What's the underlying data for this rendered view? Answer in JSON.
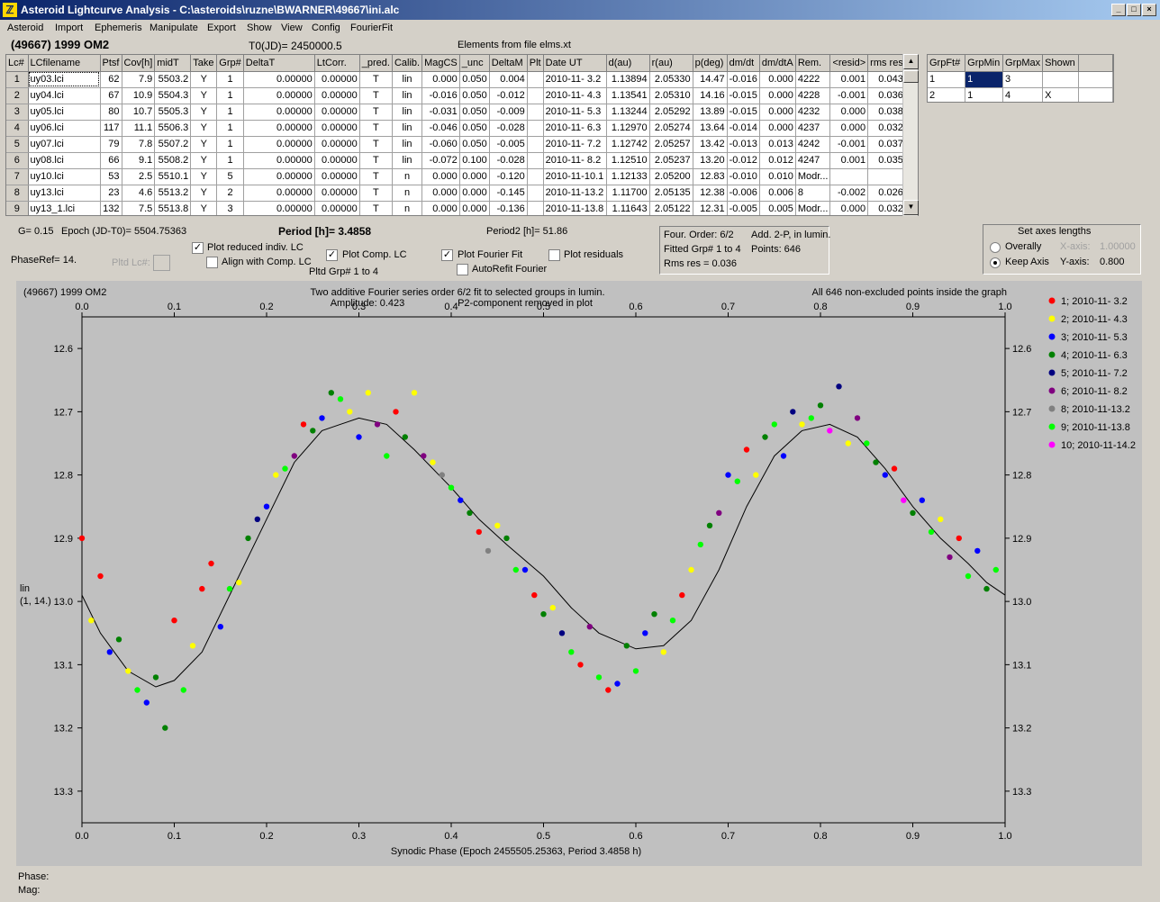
{
  "window": {
    "title": "Asteroid Lightcurve Analysis - C:\\asteroids\\ruzne\\BWARNER\\49667\\ini.alc",
    "buttons": [
      "_",
      "□",
      "×"
    ]
  },
  "menu": [
    "Asteroid",
    "Import",
    "Ephemeris",
    "Manipulate",
    "Export",
    "Show",
    "View",
    "Config",
    "FourierFit"
  ],
  "header": {
    "object": "(49667) 1999 OM2",
    "t0": "T0(JD)= 2450000.5",
    "elements": "Elements from file elms.xt"
  },
  "lc_table": {
    "columns": [
      "Lc#",
      "LCfilename",
      "Ptsf",
      "Cov[h]",
      "midT",
      "Take",
      "Grp#",
      "DeltaT",
      "LtCorr.",
      "_pred.",
      "Calib.",
      "MagCS",
      "_unc",
      "DeltaM",
      "Plt",
      "Date UT",
      "d(au)",
      "r(au)",
      "p(deg)",
      "dm/dt",
      "dm/dtA",
      "Rem.",
      "<resid>",
      "rms res"
    ],
    "rows": [
      [
        "1",
        "uy03.lci",
        "62",
        "7.9",
        "5503.2",
        "Y",
        "1",
        "0.00000",
        "0.00000",
        "T",
        "lin",
        "0.000",
        "0.050",
        "0.004",
        "",
        "2010-11- 3.2",
        "1.13894",
        "2.05330",
        "14.47",
        "-0.016",
        "0.000",
        "4222",
        "0.001",
        "0.043"
      ],
      [
        "2",
        "uy04.lci",
        "67",
        "10.9",
        "5504.3",
        "Y",
        "1",
        "0.00000",
        "0.00000",
        "T",
        "lin",
        "-0.016",
        "0.050",
        "-0.012",
        "",
        "2010-11- 4.3",
        "1.13541",
        "2.05310",
        "14.16",
        "-0.015",
        "0.000",
        "4228",
        "-0.001",
        "0.036"
      ],
      [
        "3",
        "uy05.lci",
        "80",
        "10.7",
        "5505.3",
        "Y",
        "1",
        "0.00000",
        "0.00000",
        "T",
        "lin",
        "-0.031",
        "0.050",
        "-0.009",
        "",
        "2010-11- 5.3",
        "1.13244",
        "2.05292",
        "13.89",
        "-0.015",
        "0.000",
        "4232",
        "0.000",
        "0.038"
      ],
      [
        "4",
        "uy06.lci",
        "117",
        "11.1",
        "5506.3",
        "Y",
        "1",
        "0.00000",
        "0.00000",
        "T",
        "lin",
        "-0.046",
        "0.050",
        "-0.028",
        "",
        "2010-11- 6.3",
        "1.12970",
        "2.05274",
        "13.64",
        "-0.014",
        "0.000",
        "4237",
        "0.000",
        "0.032"
      ],
      [
        "5",
        "uy07.lci",
        "79",
        "7.8",
        "5507.2",
        "Y",
        "1",
        "0.00000",
        "0.00000",
        "T",
        "lin",
        "-0.060",
        "0.050",
        "-0.005",
        "",
        "2010-11- 7.2",
        "1.12742",
        "2.05257",
        "13.42",
        "-0.013",
        "0.013",
        "4242",
        "-0.001",
        "0.037"
      ],
      [
        "6",
        "uy08.lci",
        "66",
        "9.1",
        "5508.2",
        "Y",
        "1",
        "0.00000",
        "0.00000",
        "T",
        "lin",
        "-0.072",
        "0.100",
        "-0.028",
        "",
        "2010-11- 8.2",
        "1.12510",
        "2.05237",
        "13.20",
        "-0.012",
        "0.012",
        "4247",
        "0.001",
        "0.035"
      ],
      [
        "7",
        "uy10.lci",
        "53",
        "2.5",
        "5510.1",
        "Y",
        "5",
        "0.00000",
        "0.00000",
        "T",
        "n",
        "0.000",
        "0.000",
        "-0.120",
        "",
        "2010-11-10.1",
        "1.12133",
        "2.05200",
        "12.83",
        "-0.010",
        "0.010",
        "Modr...",
        "",
        ""
      ],
      [
        "8",
        "uy13.lci",
        "23",
        "4.6",
        "5513.2",
        "Y",
        "2",
        "0.00000",
        "0.00000",
        "T",
        "n",
        "0.000",
        "0.000",
        "-0.145",
        "",
        "2010-11-13.2",
        "1.11700",
        "2.05135",
        "12.38",
        "-0.006",
        "0.006",
        "8",
        "-0.002",
        "0.026"
      ],
      [
        "9",
        "uy13_1.lci",
        "132",
        "7.5",
        "5513.8",
        "Y",
        "3",
        "0.00000",
        "0.00000",
        "T",
        "n",
        "0.000",
        "0.000",
        "-0.136",
        "",
        "2010-11-13.8",
        "1.11643",
        "2.05122",
        "12.31",
        "-0.005",
        "0.005",
        "Modr...",
        "0.000",
        "0.032"
      ]
    ]
  },
  "grp_table": {
    "columns": [
      "GrpFt#",
      "GrpMin",
      "GrpMax",
      "Shown"
    ],
    "rows": [
      [
        "1",
        "1",
        "3",
        ""
      ],
      [
        "2",
        "1",
        "4",
        "X"
      ]
    ]
  },
  "controls": {
    "g": "G= 0.15",
    "epoch": "Epoch (JD-T0)= 5504.75363",
    "period": "Period [h]= 3.4858",
    "period2": "Period2 [h]= 51.86",
    "phaseref": "PhaseRef= 14.",
    "pltd_lc": "Pltd Lc#:",
    "plot_reduced": "Plot reduced indiv. LC",
    "align_comp": "Align with Comp. LC",
    "plot_comp": "Plot Comp. LC",
    "pltd_grp": "Pltd Grp#  1   to   4",
    "plot_fourier": "Plot Fourier Fit",
    "autorefit": "AutoRefit Fourier",
    "plot_residuals": "Plot residuals",
    "checks": {
      "plot_reduced": true,
      "align_comp": false,
      "plot_comp": true,
      "plot_fourier": true,
      "autorefit": false,
      "plot_residuals": false
    }
  },
  "fourier_info": {
    "order": "Four. Order:  6/2",
    "add": "Add. 2-P, in lumin.",
    "fitted": "Fitted Grp# 1 to 4",
    "points": "Points: 646",
    "rms": "Rms res      = 0.036"
  },
  "axes_panel": {
    "title": "Set axes lengths",
    "overally": "Overally",
    "keep": "Keep Axis",
    "xlabel": "X-axis:",
    "xvalue": "1.00000",
    "ylabel": "Y-axis:",
    "yvalue": "0.800",
    "selected": "keep"
  },
  "chart_data": {
    "type": "scatter",
    "title": "Two additive Fourier series order 6/2 fit to selected groups in lumin.",
    "subtitle_left": "Amplitude: 0.423",
    "subtitle_right": "P2-component removed in plot",
    "object_label": "(49667) 1999 OM2",
    "right_note": "All 646 non-excluded points inside the graph",
    "xlabel": "Synodic Phase (Epoch 2455505.25363, Period 3.4858 h)",
    "ylabel": [
      "lin",
      "(1, 14.)"
    ],
    "xlim": [
      0,
      1
    ],
    "ylim": [
      13.35,
      12.55
    ],
    "xticks": [
      "0.0",
      "0.1",
      "0.2",
      "0.3",
      "0.4",
      "0.5",
      "0.6",
      "0.7",
      "0.8",
      "0.9",
      "1.0"
    ],
    "yticks": [
      "12.6",
      "12.7",
      "12.8",
      "12.9",
      "13.0",
      "13.1",
      "13.2",
      "13.3"
    ],
    "legend_position": "right",
    "series": [
      {
        "name": "1; 2010-11- 3.2",
        "color": "#ff0000"
      },
      {
        "name": "2; 2010-11- 4.3",
        "color": "#ffff00"
      },
      {
        "name": "3; 2010-11- 5.3",
        "color": "#0000ff"
      },
      {
        "name": "4; 2010-11- 6.3",
        "color": "#008000"
      },
      {
        "name": "5; 2010-11- 7.2",
        "color": "#000080"
      },
      {
        "name": "6; 2010-11- 8.2",
        "color": "#800080"
      },
      {
        "name": "8; 2010-11-13.2",
        "color": "#808080"
      },
      {
        "name": "9; 2010-11-13.8",
        "color": "#00ff00"
      },
      {
        "name": "10; 2010-11-14.2",
        "color": "#ff00ff"
      }
    ],
    "fit_curve": [
      [
        0.0,
        12.99
      ],
      [
        0.02,
        13.05
      ],
      [
        0.05,
        13.11
      ],
      [
        0.08,
        13.135
      ],
      [
        0.1,
        13.125
      ],
      [
        0.13,
        13.08
      ],
      [
        0.16,
        12.99
      ],
      [
        0.2,
        12.87
      ],
      [
        0.23,
        12.78
      ],
      [
        0.26,
        12.73
      ],
      [
        0.3,
        12.71
      ],
      [
        0.33,
        12.72
      ],
      [
        0.36,
        12.76
      ],
      [
        0.4,
        12.82
      ],
      [
        0.43,
        12.87
      ],
      [
        0.46,
        12.91
      ],
      [
        0.5,
        12.96
      ],
      [
        0.53,
        13.01
      ],
      [
        0.56,
        13.05
      ],
      [
        0.6,
        13.075
      ],
      [
        0.63,
        13.07
      ],
      [
        0.66,
        13.03
      ],
      [
        0.69,
        12.95
      ],
      [
        0.72,
        12.85
      ],
      [
        0.75,
        12.77
      ],
      [
        0.78,
        12.73
      ],
      [
        0.81,
        12.72
      ],
      [
        0.84,
        12.74
      ],
      [
        0.87,
        12.79
      ],
      [
        0.9,
        12.85
      ],
      [
        0.93,
        12.9
      ],
      [
        0.96,
        12.94
      ],
      [
        0.98,
        12.97
      ],
      [
        1.0,
        12.99
      ]
    ],
    "points": [
      [
        0.0,
        12.9,
        0
      ],
      [
        0.01,
        13.03,
        1
      ],
      [
        0.02,
        12.96,
        0
      ],
      [
        0.03,
        13.08,
        2
      ],
      [
        0.04,
        13.06,
        3
      ],
      [
        0.05,
        13.11,
        1
      ],
      [
        0.06,
        13.14,
        7
      ],
      [
        0.07,
        13.16,
        2
      ],
      [
        0.08,
        13.12,
        3
      ],
      [
        0.09,
        13.2,
        3
      ],
      [
        0.1,
        13.03,
        0
      ],
      [
        0.11,
        13.14,
        7
      ],
      [
        0.12,
        13.07,
        1
      ],
      [
        0.13,
        12.98,
        0
      ],
      [
        0.14,
        12.94,
        0
      ],
      [
        0.15,
        13.04,
        2
      ],
      [
        0.16,
        12.98,
        7
      ],
      [
        0.17,
        12.97,
        1
      ],
      [
        0.18,
        12.9,
        3
      ],
      [
        0.19,
        12.87,
        4
      ],
      [
        0.2,
        12.85,
        2
      ],
      [
        0.21,
        12.8,
        1
      ],
      [
        0.22,
        12.79,
        7
      ],
      [
        0.23,
        12.77,
        5
      ],
      [
        0.24,
        12.72,
        0
      ],
      [
        0.25,
        12.73,
        3
      ],
      [
        0.26,
        12.71,
        2
      ],
      [
        0.27,
        12.67,
        3
      ],
      [
        0.28,
        12.68,
        7
      ],
      [
        0.29,
        12.7,
        1
      ],
      [
        0.3,
        12.74,
        2
      ],
      [
        0.31,
        12.67,
        1
      ],
      [
        0.32,
        12.72,
        5
      ],
      [
        0.33,
        12.77,
        7
      ],
      [
        0.34,
        12.7,
        0
      ],
      [
        0.35,
        12.74,
        3
      ],
      [
        0.36,
        12.67,
        1
      ],
      [
        0.37,
        12.77,
        5
      ],
      [
        0.38,
        12.78,
        1
      ],
      [
        0.39,
        12.8,
        6
      ],
      [
        0.4,
        12.82,
        7
      ],
      [
        0.41,
        12.84,
        2
      ],
      [
        0.42,
        12.86,
        3
      ],
      [
        0.43,
        12.89,
        0
      ],
      [
        0.44,
        12.92,
        6
      ],
      [
        0.45,
        12.88,
        1
      ],
      [
        0.46,
        12.9,
        3
      ],
      [
        0.47,
        12.95,
        7
      ],
      [
        0.48,
        12.95,
        2
      ],
      [
        0.49,
        12.99,
        0
      ],
      [
        0.5,
        13.02,
        3
      ],
      [
        0.51,
        13.01,
        1
      ],
      [
        0.52,
        13.05,
        4
      ],
      [
        0.53,
        13.08,
        7
      ],
      [
        0.54,
        13.1,
        0
      ],
      [
        0.55,
        13.04,
        5
      ],
      [
        0.56,
        13.12,
        7
      ],
      [
        0.57,
        13.14,
        0
      ],
      [
        0.58,
        13.13,
        2
      ],
      [
        0.59,
        13.07,
        3
      ],
      [
        0.6,
        13.11,
        7
      ],
      [
        0.61,
        13.05,
        2
      ],
      [
        0.62,
        13.02,
        3
      ],
      [
        0.63,
        13.08,
        1
      ],
      [
        0.64,
        13.03,
        7
      ],
      [
        0.65,
        12.99,
        0
      ],
      [
        0.66,
        12.95,
        1
      ],
      [
        0.67,
        12.91,
        7
      ],
      [
        0.68,
        12.88,
        3
      ],
      [
        0.69,
        12.86,
        5
      ],
      [
        0.7,
        12.8,
        2
      ],
      [
        0.71,
        12.81,
        7
      ],
      [
        0.72,
        12.76,
        0
      ],
      [
        0.73,
        12.8,
        1
      ],
      [
        0.74,
        12.74,
        3
      ],
      [
        0.75,
        12.72,
        7
      ],
      [
        0.76,
        12.77,
        2
      ],
      [
        0.77,
        12.7,
        4
      ],
      [
        0.78,
        12.72,
        1
      ],
      [
        0.79,
        12.71,
        7
      ],
      [
        0.8,
        12.69,
        3
      ],
      [
        0.81,
        12.73,
        8
      ],
      [
        0.82,
        12.66,
        4
      ],
      [
        0.83,
        12.75,
        1
      ],
      [
        0.84,
        12.71,
        5
      ],
      [
        0.85,
        12.75,
        7
      ],
      [
        0.86,
        12.78,
        3
      ],
      [
        0.87,
        12.8,
        2
      ],
      [
        0.88,
        12.79,
        0
      ],
      [
        0.89,
        12.84,
        8
      ],
      [
        0.9,
        12.86,
        3
      ],
      [
        0.91,
        12.84,
        2
      ],
      [
        0.92,
        12.89,
        7
      ],
      [
        0.93,
        12.87,
        1
      ],
      [
        0.94,
        12.93,
        5
      ],
      [
        0.95,
        12.9,
        0
      ],
      [
        0.96,
        12.96,
        7
      ],
      [
        0.97,
        12.92,
        2
      ],
      [
        0.98,
        12.98,
        3
      ],
      [
        0.99,
        12.95,
        7
      ]
    ]
  },
  "status": {
    "phase": "Phase:",
    "mag": "Mag:"
  }
}
